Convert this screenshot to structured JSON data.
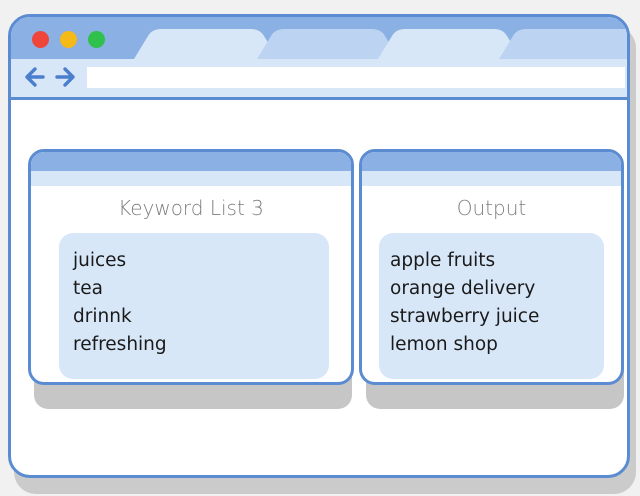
{
  "colors": {
    "accent": "#5b8bd0",
    "titlebar": "#8ab0e4",
    "light": "#d8e7f8",
    "close": "#f0453b",
    "minimize": "#f5b918",
    "maximize": "#30c14d"
  },
  "toolbar": {
    "back_icon": "arrow-left-icon",
    "forward_icon": "arrow-right-icon",
    "address_value": ""
  },
  "panels": {
    "keywords": {
      "title": "Keyword List 3",
      "items": [
        "juices",
        "tea",
        "drinnk",
        "refreshing"
      ]
    },
    "output": {
      "title": "Output",
      "items": [
        "apple fruits",
        "orange delivery",
        "strawberry juice",
        "lemon shop"
      ]
    }
  }
}
